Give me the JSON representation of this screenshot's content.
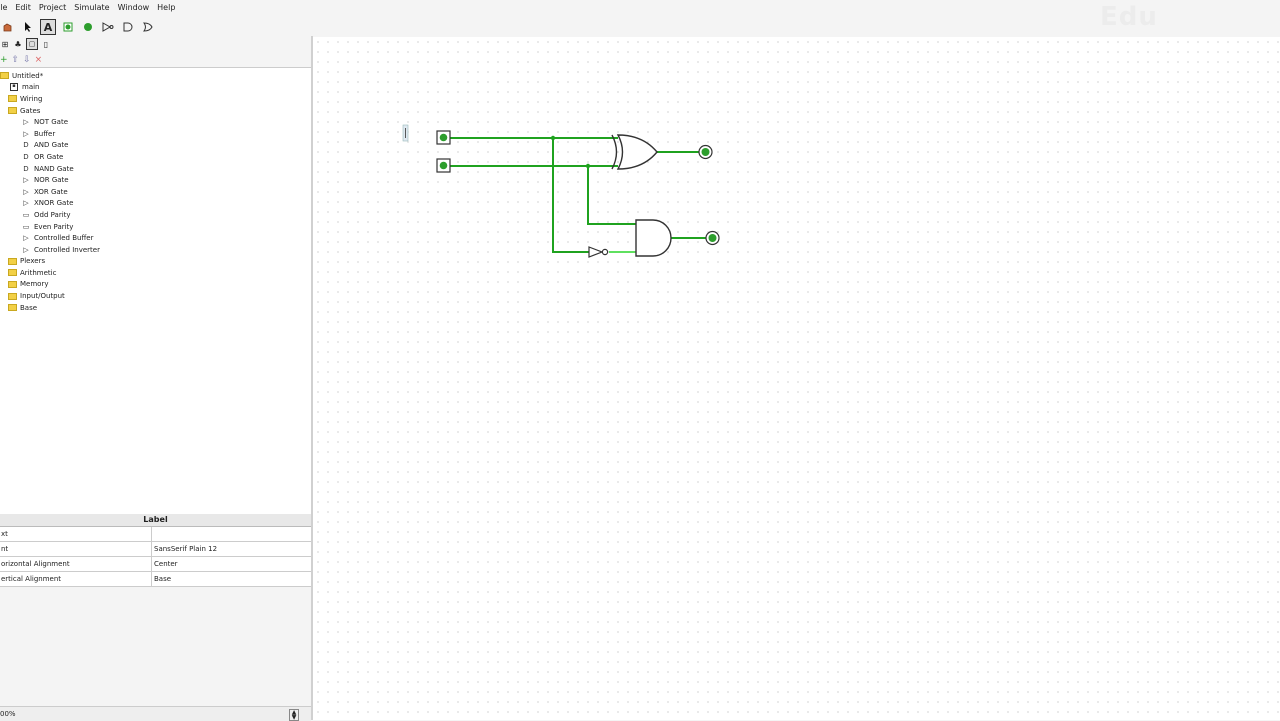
{
  "menu": [
    "ile",
    "Edit",
    "Project",
    "Simulate",
    "Window",
    "Help"
  ],
  "watermark": "Edu",
  "tree": {
    "project": "Untitled*",
    "main": "main",
    "libraries": [
      {
        "label": "Wiring"
      },
      {
        "label": "Gates",
        "children": [
          {
            "icon": "not-gate-icon",
            "glyph": "▷",
            "label": "NOT Gate"
          },
          {
            "icon": "buffer-icon",
            "glyph": "▷",
            "label": "Buffer"
          },
          {
            "icon": "and-gate-icon",
            "glyph": "D",
            "label": "AND Gate"
          },
          {
            "icon": "or-gate-icon",
            "glyph": "D",
            "label": "OR Gate"
          },
          {
            "icon": "nand-gate-icon",
            "glyph": "D",
            "label": "NAND Gate"
          },
          {
            "icon": "nor-gate-icon",
            "glyph": "▷",
            "label": "NOR Gate"
          },
          {
            "icon": "xor-gate-icon",
            "glyph": "▷",
            "label": "XOR Gate"
          },
          {
            "icon": "xnor-gate-icon",
            "glyph": "▷",
            "label": "XNOR Gate"
          },
          {
            "icon": "odd-parity-icon",
            "glyph": "▭",
            "label": "Odd Parity"
          },
          {
            "icon": "even-parity-icon",
            "glyph": "▭",
            "label": "Even Parity"
          },
          {
            "icon": "controlled-buffer-icon",
            "glyph": "▷",
            "label": "Controlled Buffer"
          },
          {
            "icon": "controlled-inverter-icon",
            "glyph": "▷",
            "label": "Controlled Inverter"
          }
        ]
      },
      {
        "label": "Plexers"
      },
      {
        "label": "Arithmetic"
      },
      {
        "label": "Memory"
      },
      {
        "label": "Input/Output"
      },
      {
        "label": "Base"
      }
    ]
  },
  "properties": {
    "title": "Label",
    "rows": [
      {
        "key": "xt",
        "value": ""
      },
      {
        "key": "nt",
        "value": "SansSerif Plain 12"
      },
      {
        "key": "orizontal Alignment",
        "value": "Center"
      },
      {
        "key": "ertical Alignment",
        "value": "Base"
      }
    ]
  },
  "status": {
    "zoom": "00%"
  },
  "colors": {
    "wire_on": "#1fa21f",
    "wire_light": "#5fe05f",
    "pin_led": "#2d9e2d"
  }
}
